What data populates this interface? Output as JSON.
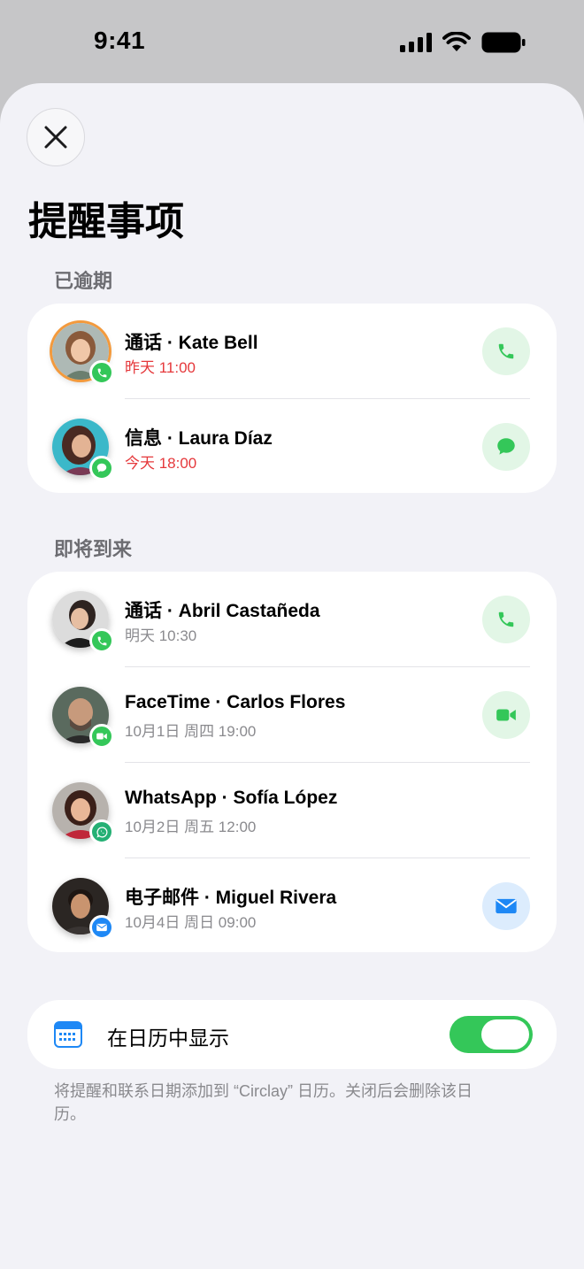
{
  "status_bar": {
    "time": "9:41"
  },
  "page_title": "提醒事项",
  "sections": {
    "overdue": {
      "header": "已逾期",
      "items": [
        {
          "title": "通话 · Kate Bell",
          "subtitle": "昨天 11:00",
          "type": "call",
          "icon": "phone-icon"
        },
        {
          "title": "信息 · Laura Díaz",
          "subtitle": "今天 18:00",
          "type": "message",
          "icon": "message-icon"
        }
      ]
    },
    "upcoming": {
      "header": "即将到来",
      "items": [
        {
          "title": "通话 · Abril Castañeda",
          "subtitle": "明天 10:30",
          "type": "call",
          "icon": "phone-icon"
        },
        {
          "title": "FaceTime · Carlos Flores",
          "subtitle": "10月1日 周四 19:00",
          "type": "facetime",
          "icon": "video-icon"
        },
        {
          "title": "WhatsApp · Sofía López",
          "subtitle": "10月2日 周五 12:00",
          "type": "whatsapp",
          "icon": "whatsapp-icon"
        },
        {
          "title": "电子邮件 · Miguel Rivera",
          "subtitle": "10月4日 周日 09:00",
          "type": "email",
          "icon": "mail-icon"
        }
      ]
    }
  },
  "calendar_toggle": {
    "label": "在日历中显示",
    "enabled": true
  },
  "footnote": "将提醒和联系日期添加到 “Circlay” 日历。关闭后会删除该日历。",
  "colors": {
    "green": "#34c759",
    "green_bg": "#e2f6e6",
    "blue": "#1e88f5",
    "blue_bg": "#dcecfd",
    "overdue_red": "#e5383b",
    "ring_orange": "#f39a3d"
  }
}
